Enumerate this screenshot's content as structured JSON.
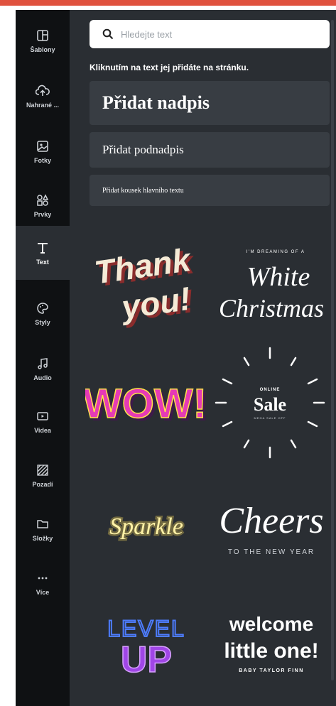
{
  "sidebar": {
    "items": [
      {
        "label": "Šablony",
        "icon": "template-icon"
      },
      {
        "label": "Nahrané ...",
        "icon": "cloud-upload-icon"
      },
      {
        "label": "Fotky",
        "icon": "image-icon"
      },
      {
        "label": "Prvky",
        "icon": "shapes-icon"
      },
      {
        "label": "Text",
        "icon": "text-icon"
      },
      {
        "label": "Styly",
        "icon": "palette-icon"
      },
      {
        "label": "Audio",
        "icon": "music-note-icon"
      },
      {
        "label": "Videa",
        "icon": "video-icon"
      },
      {
        "label": "Pozadí",
        "icon": "pattern-icon"
      },
      {
        "label": "Složky",
        "icon": "folder-icon"
      },
      {
        "label": "Více",
        "icon": "more-icon"
      }
    ],
    "active": "Text"
  },
  "search": {
    "placeholder": "Hledejte text"
  },
  "hint": "Kliknutím na text jej přidáte na stránku.",
  "add": {
    "heading": "Přidat nadpis",
    "subheading": "Přidat podnadpis",
    "body": "Přidat kousek hlavního textu"
  },
  "templates": {
    "thank_you": {
      "line1": "Thank",
      "line2": "you!"
    },
    "white_christmas": {
      "small": "I'M DREAMING OF A",
      "line1": "White",
      "line2": "Christmas"
    },
    "wow": {
      "text": "WOW!"
    },
    "sale": {
      "small": "ONLINE",
      "main": "Sale",
      "bottom": "MEGA SALE OFF"
    },
    "sparkle": {
      "text": "Sparkle"
    },
    "cheers": {
      "main": "Cheers",
      "sub": "TO THE NEW YEAR"
    },
    "level_up": {
      "line1": "LEVEL",
      "line2": "UP"
    },
    "welcome": {
      "line1": "welcome",
      "line2": "little one!",
      "sub": "BABY TAYLOR FINN"
    }
  },
  "colors": {
    "sidebar_bg": "#0f1113",
    "panel_bg": "#2a2e33",
    "add_box_bg": "#383d43",
    "accent_bar": "#e0523f"
  }
}
